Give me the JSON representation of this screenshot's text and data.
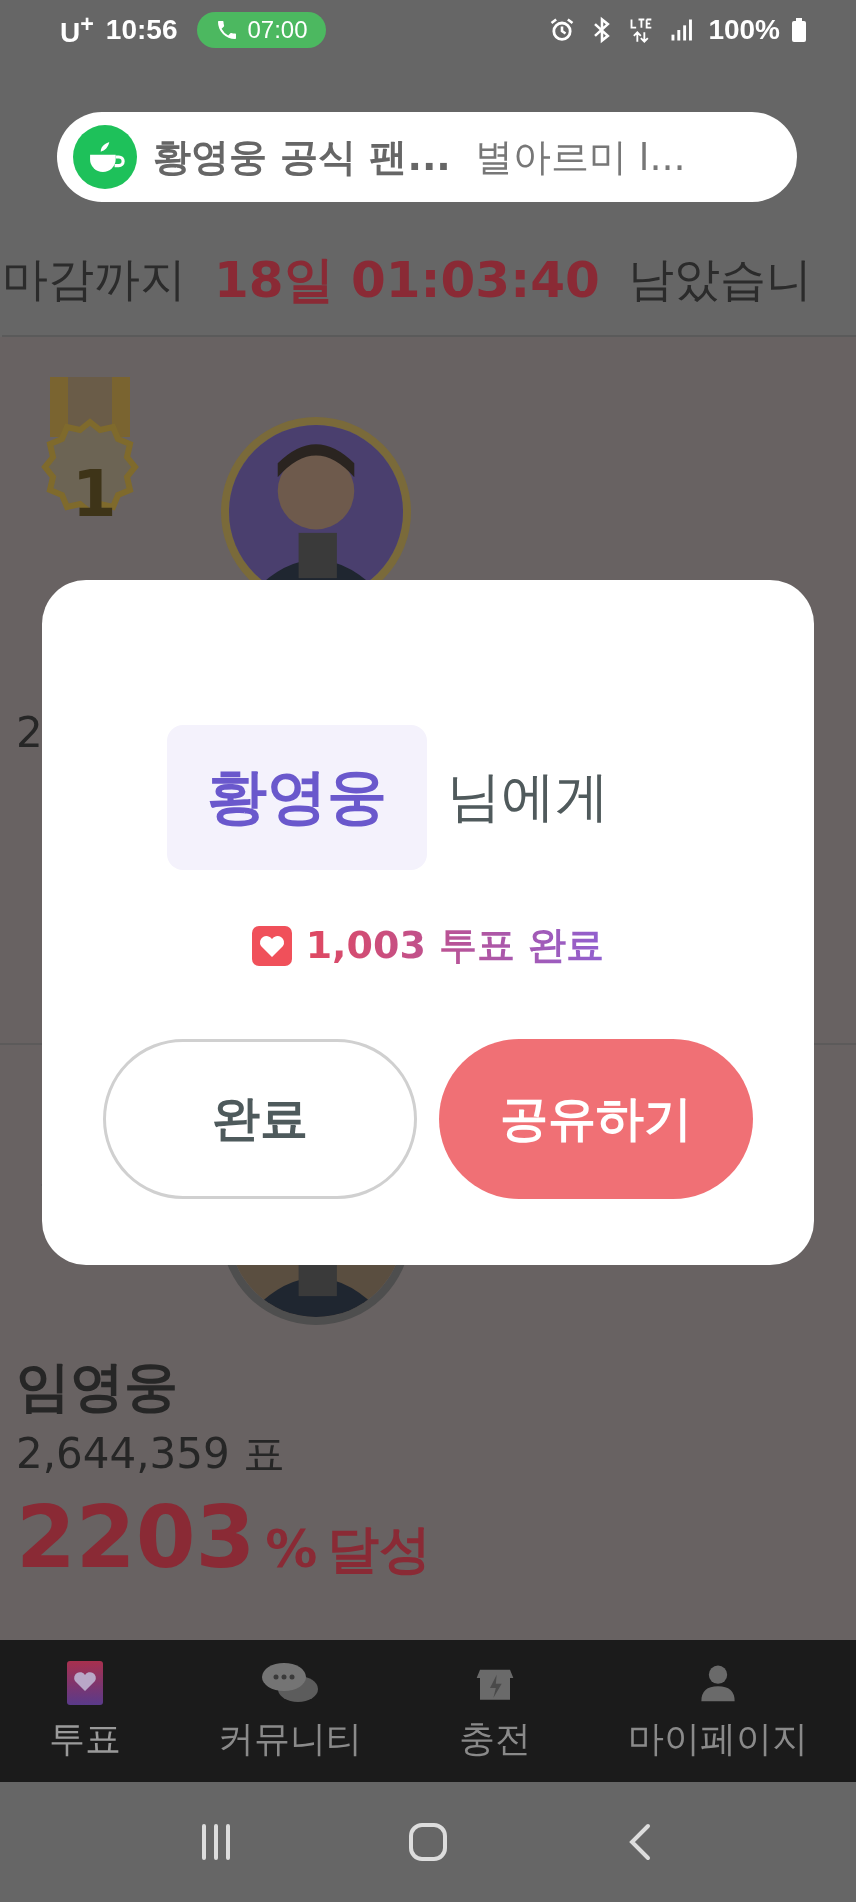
{
  "status_bar": {
    "carrier": "U$^{+}$",
    "time": "10:56",
    "call_timer": "07:00",
    "battery": "100%"
  },
  "notification": {
    "title": "황영웅 공식 팬...",
    "text": "별아르미 l..."
  },
  "countdown": {
    "prefix": "마감까지",
    "time": "18일 01:03:40",
    "suffix": "남았습니"
  },
  "rankings": [
    {
      "kind": "gold",
      "rank": "1",
      "votes": "2"
    },
    {
      "kind": "silver",
      "name": "임영웅",
      "votes": "2,644,359 표",
      "percent": "2203",
      "percent_unit": "%",
      "achieved": "달성"
    }
  ],
  "dialog": {
    "recipient": "황영웅",
    "suffix": "님에게",
    "result": "1,003 투표 완료",
    "buttons": [
      {
        "label": "완료",
        "kind": "secondary"
      },
      {
        "label": "공유하기",
        "kind": "primary"
      }
    ]
  },
  "bottom_nav": [
    {
      "label": "투표",
      "kind": "vote",
      "selected": true
    },
    {
      "label": "커뮤니티",
      "kind": "community",
      "selected": false
    },
    {
      "label": "충전",
      "kind": "charge",
      "selected": false
    },
    {
      "label": "마이페이지",
      "kind": "mypage",
      "selected": false
    }
  ]
}
